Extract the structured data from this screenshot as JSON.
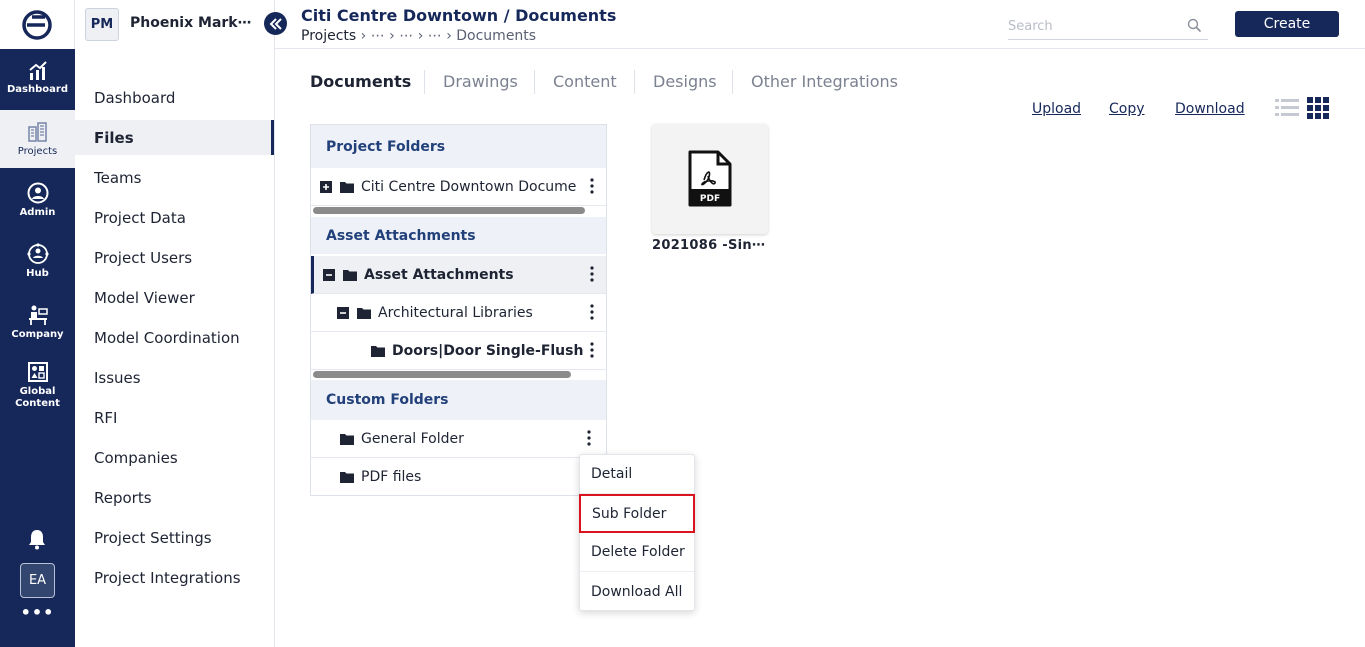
{
  "rail": {
    "items": [
      {
        "label": "Dashboard",
        "icon": "dashboard-chart-icon"
      },
      {
        "label": "Projects",
        "icon": "projects-building-icon",
        "active": true
      },
      {
        "label": "Admin",
        "icon": "admin-user-icon"
      },
      {
        "label": "Hub",
        "icon": "hub-network-icon"
      },
      {
        "label": "Company",
        "icon": "company-desk-icon"
      },
      {
        "label": "Global Content",
        "icon": "global-content-icon"
      }
    ],
    "avatar": "EA",
    "more": "•••"
  },
  "project": {
    "badge": "PM",
    "name": "Phoenix Mark⋯"
  },
  "nav": {
    "items": [
      {
        "label": "Dashboard"
      },
      {
        "label": "Files",
        "active": true
      },
      {
        "label": "Teams"
      },
      {
        "label": "Project Data"
      },
      {
        "label": "Project Users"
      },
      {
        "label": "Model Viewer"
      },
      {
        "label": "Model Coordination"
      },
      {
        "label": "Issues"
      },
      {
        "label": "RFI"
      },
      {
        "label": "Companies"
      },
      {
        "label": "Reports"
      },
      {
        "label": "Project Settings"
      },
      {
        "label": "Project Integrations"
      }
    ]
  },
  "header": {
    "title": "Citi Centre Downtown / Documents",
    "breadcrumb": [
      "Projects",
      "⋯",
      "⋯",
      "⋯",
      "Documents"
    ],
    "search_placeholder": "Search",
    "create_label": "Create"
  },
  "tabs": [
    {
      "label": "Documents",
      "active": true
    },
    {
      "label": "Drawings"
    },
    {
      "label": "Content"
    },
    {
      "label": "Designs"
    },
    {
      "label": "Other Integrations"
    }
  ],
  "actions": {
    "upload": "Upload",
    "copy": "Copy",
    "download": "Download"
  },
  "tree": {
    "project_folders_title": "Project Folders",
    "project_folders": [
      {
        "label": "Citi Centre Downtown Docume",
        "toggle": "expand"
      }
    ],
    "asset_title": "Asset Attachments",
    "asset_rows": [
      {
        "label": "Asset Attachments",
        "toggle": "collapse",
        "selected": true
      },
      {
        "label": "Architectural Libraries",
        "toggle": "collapse"
      },
      {
        "label": "Doors|Door Single-Flush"
      }
    ],
    "custom_title": "Custom Folders",
    "custom_rows": [
      {
        "label": "General Folder"
      },
      {
        "label": "PDF files"
      }
    ]
  },
  "file": {
    "name": "2021086 -Sin⋯",
    "type_label": "PDF"
  },
  "context_menu": {
    "items": [
      "Detail",
      "Sub Folder",
      "Delete Folder",
      "Download All"
    ],
    "highlighted": "Sub Folder"
  },
  "colors": {
    "brand_navy": "#16285a",
    "section_bg": "#eef1f7",
    "highlight_red": "#d9141e"
  }
}
